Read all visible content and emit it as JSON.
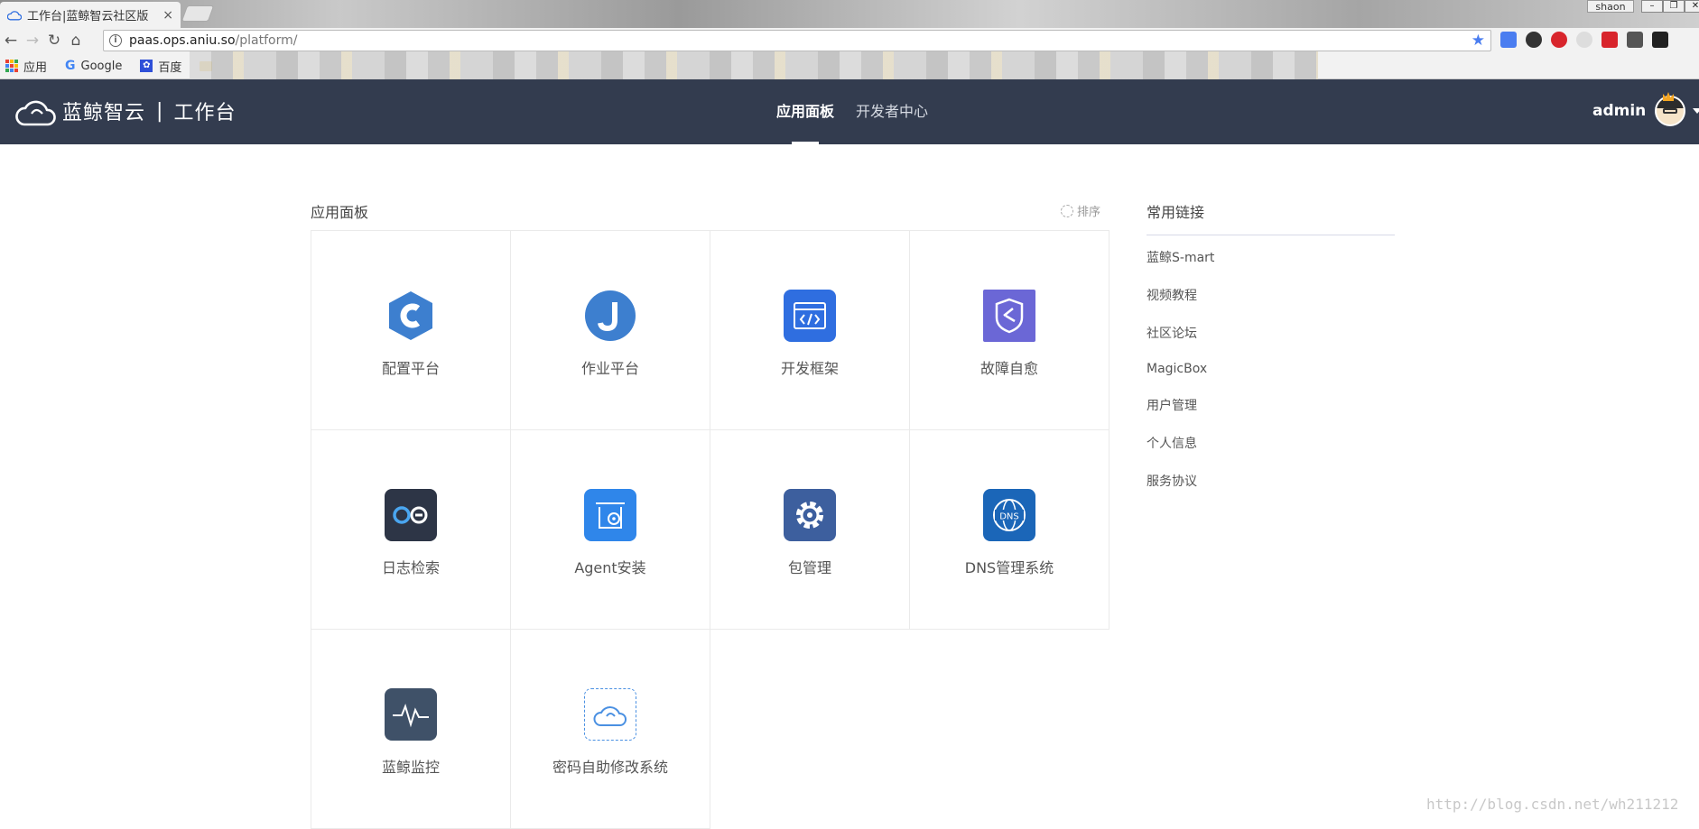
{
  "browser": {
    "tab_title": "工作台|蓝鲸智云社区版",
    "tab_close": "×",
    "window_user": "shaon",
    "url_host": "paas.ops.aniu.so",
    "url_path": "/platform/",
    "bookmarks": [
      {
        "label": "应用",
        "icon": "apps-icon"
      },
      {
        "label": "Google",
        "icon": "google-icon"
      },
      {
        "label": "百度",
        "icon": "baidu-icon"
      }
    ]
  },
  "header": {
    "brand": "蓝鲸智云",
    "separator": "|",
    "subtitle": "工作台",
    "nav": [
      {
        "label": "应用面板",
        "active": true
      },
      {
        "label": "开发者中心",
        "active": false
      }
    ],
    "username": "admin"
  },
  "panel": {
    "title": "应用面板",
    "sort_label": "排序",
    "apps": [
      {
        "name": "配置平台",
        "icon": "config-platform-icon",
        "color": "#3d7fcf"
      },
      {
        "name": "作业平台",
        "icon": "job-platform-icon",
        "color": "#3d7fcf"
      },
      {
        "name": "开发框架",
        "icon": "dev-framework-icon",
        "color": "#2f6ee0"
      },
      {
        "name": "故障自愈",
        "icon": "fault-healing-icon",
        "color": "#6b67d6"
      },
      {
        "name": "日志检索",
        "icon": "log-search-icon",
        "color": "#2d3546"
      },
      {
        "name": "Agent安装",
        "icon": "agent-install-icon",
        "color": "#2f86ea"
      },
      {
        "name": "包管理",
        "icon": "package-gear-icon",
        "color": "#3d5f9e"
      },
      {
        "name": "DNS管理系统",
        "icon": "dns-icon",
        "color": "#1b66b8"
      },
      {
        "name": "蓝鲸监控",
        "icon": "monitor-icon",
        "color": "#3f5168"
      },
      {
        "name": "密码自助修改系统",
        "icon": "password-cloud-icon",
        "color": "#4a90e2"
      }
    ]
  },
  "links": {
    "title": "常用链接",
    "items": [
      "蓝鲸S-mart",
      "视频教程",
      "社区论坛",
      "MagicBox",
      "用户管理",
      "个人信息",
      "服务协议"
    ]
  },
  "watermark": "http://blog.csdn.net/wh211212"
}
